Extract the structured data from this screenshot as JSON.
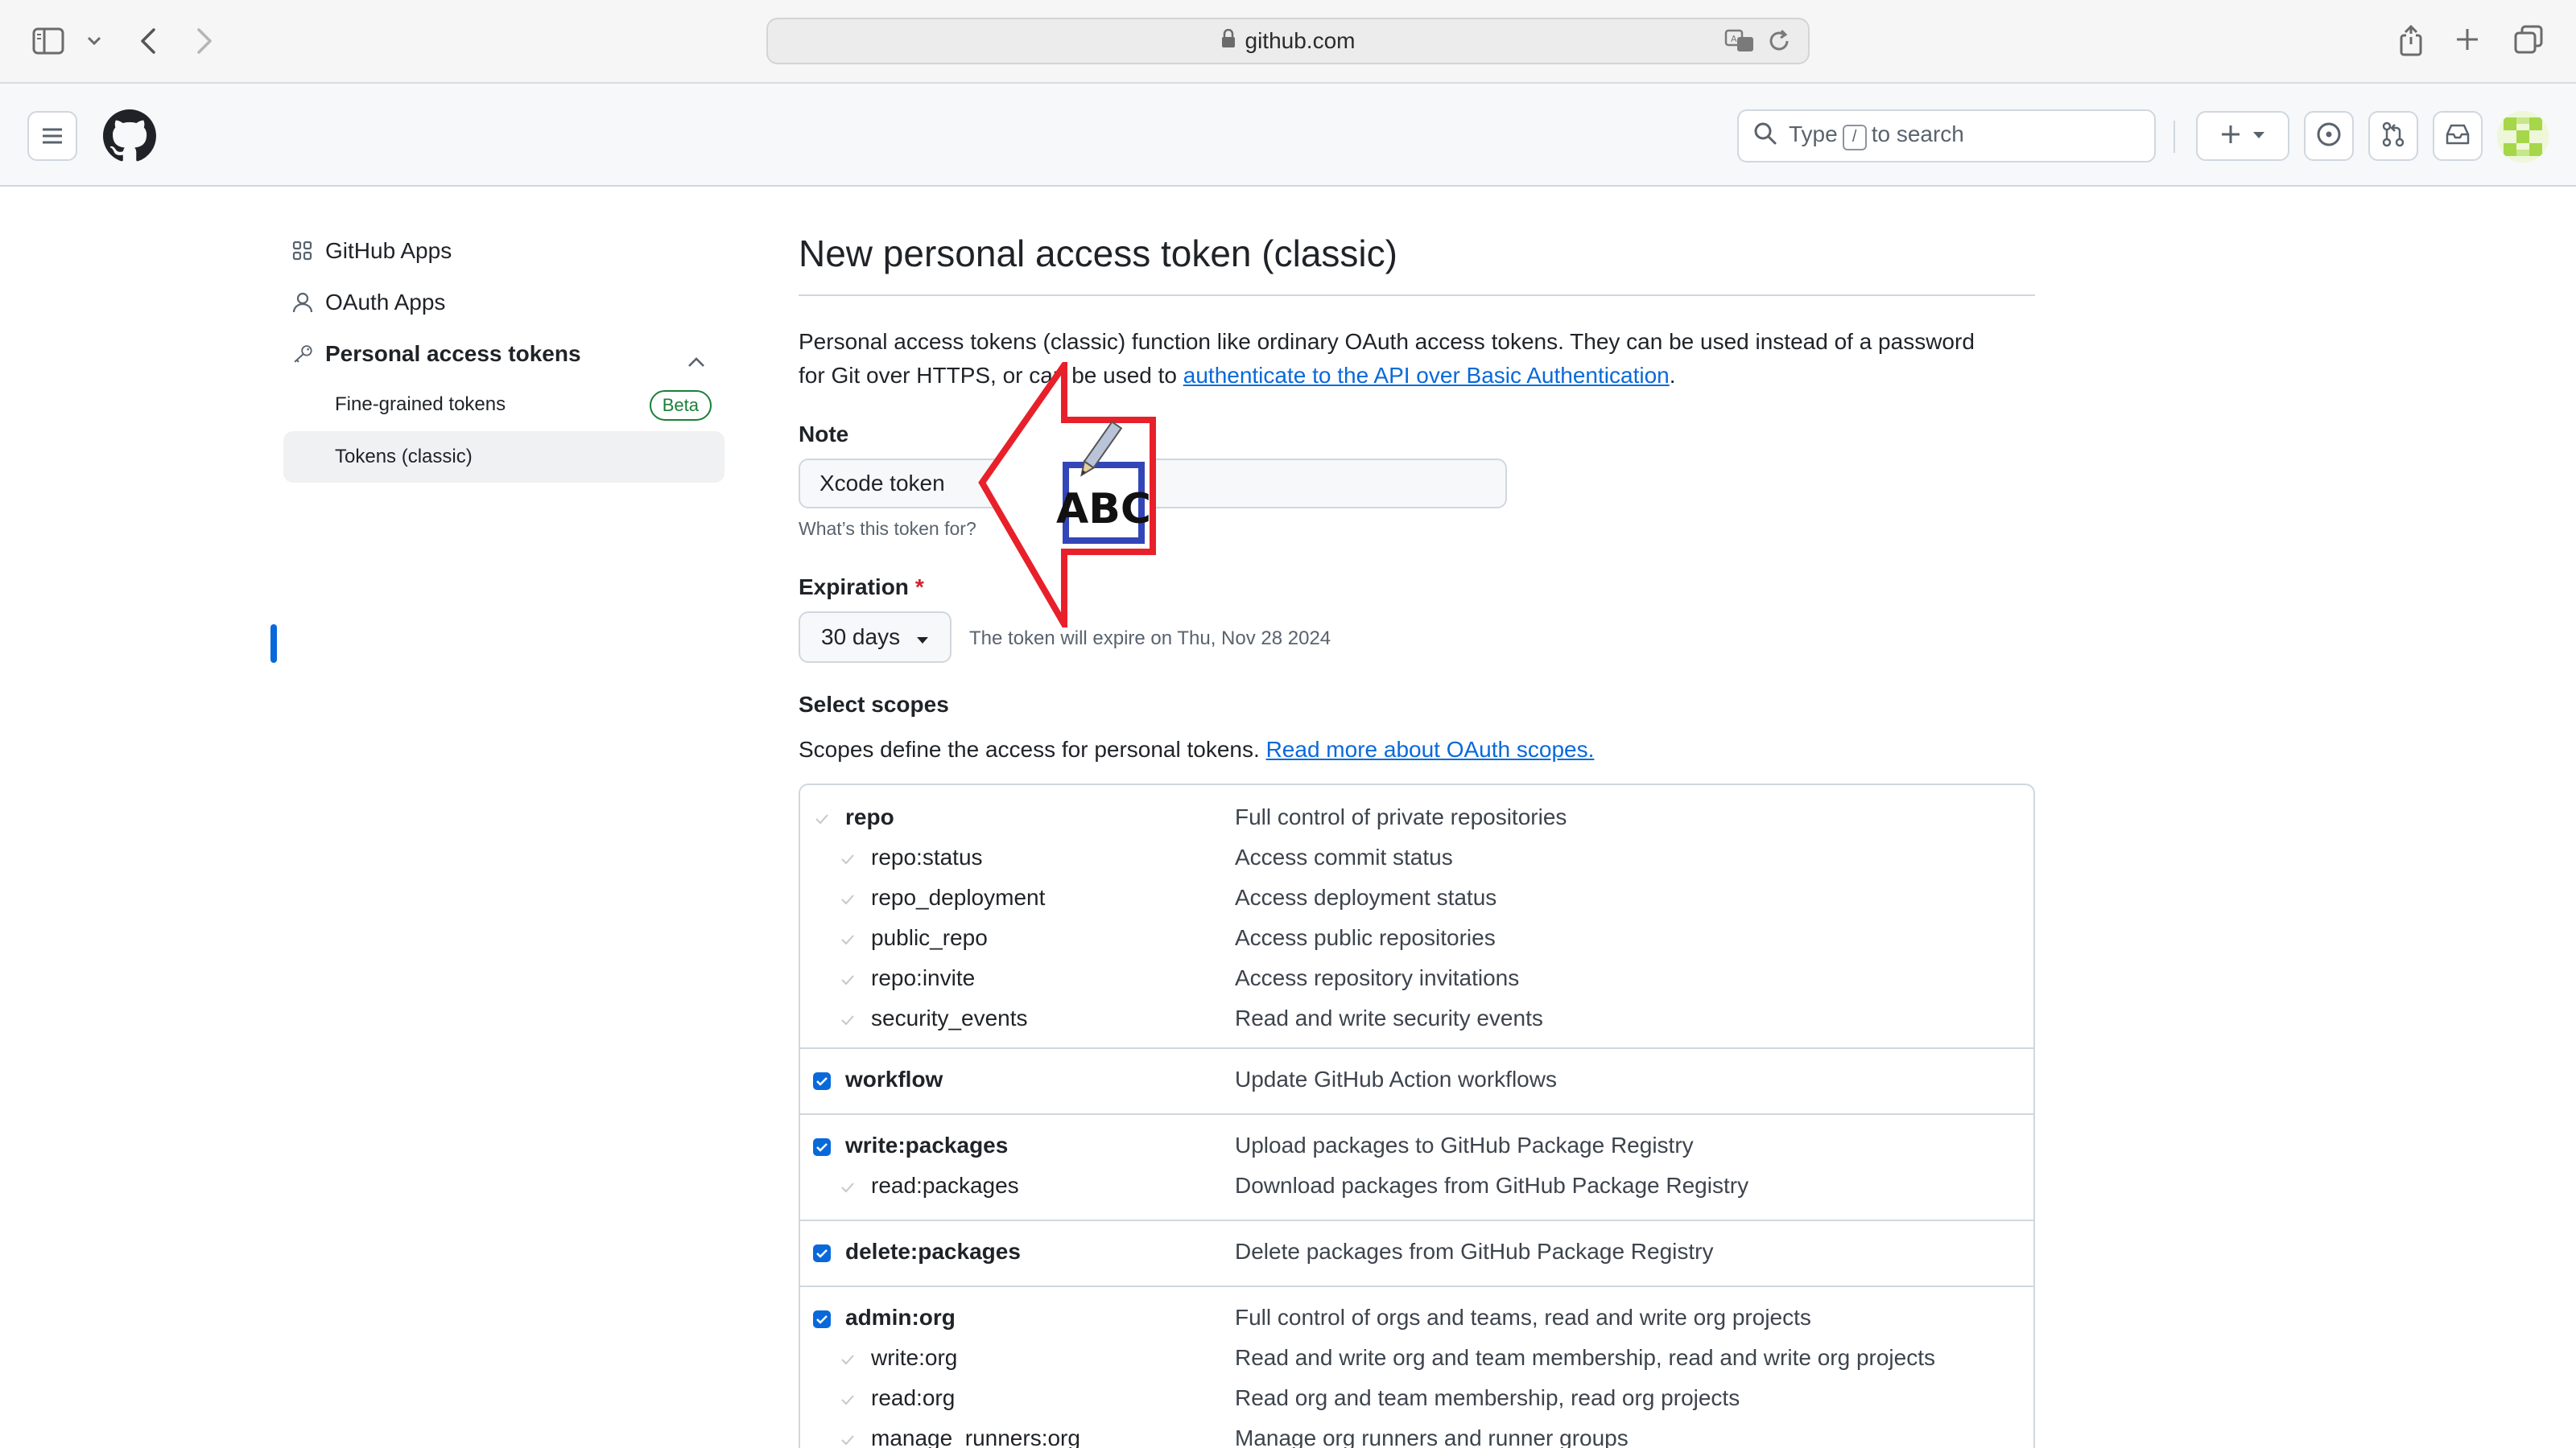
{
  "browser": {
    "url": "github.com",
    "icons": [
      "sidebar-icon",
      "chevron-down-icon",
      "back-icon",
      "forward-icon",
      "lock-icon",
      "translate-icon",
      "reload-icon",
      "share-icon",
      "new-tab-icon",
      "tab-overview-icon"
    ]
  },
  "header": {
    "search_prefix": "Type",
    "search_key": "/",
    "search_suffix": "to search",
    "icons": [
      "hamburger-icon",
      "github-logo-icon",
      "search-icon",
      "plus-icon",
      "chevron-down-icon",
      "issue-icon",
      "pull-request-icon",
      "inbox-icon"
    ]
  },
  "sidebar": {
    "github_apps": "GitHub Apps",
    "oauth_apps": "OAuth Apps",
    "personal_tokens": "Personal access tokens",
    "fine_grained": "Fine-grained tokens",
    "beta": "Beta",
    "tokens_classic": "Tokens (classic)"
  },
  "main": {
    "title": "New personal access token (classic)",
    "intro_1": "Personal access tokens (classic) function like ordinary OAuth access tokens. They can be used instead of a password",
    "intro_2": "for Git over HTTPS, or can be used to",
    "intro_link": "authenticate to the API over Basic Authentication",
    "intro_end": ".",
    "note_label": "Note",
    "note_value": "Xcode token",
    "note_hint": "What’s this token for?",
    "expiration_label": "Expiration",
    "required_mark": "*",
    "expiration_value": "30 days",
    "expiration_text": "The token will expire on Thu, Nov 28 2024",
    "scopes_label": "Select scopes",
    "scopes_desc": "Scopes define the access for personal tokens.",
    "scopes_link": "Read more about OAuth scopes."
  },
  "scopes": [
    {
      "name": "repo",
      "desc": "Full control of private repositories"
    },
    {
      "name": "repo:status",
      "desc": "Access commit status"
    },
    {
      "name": "repo_deployment",
      "desc": "Access deployment status"
    },
    {
      "name": "public_repo",
      "desc": "Access public repositories"
    },
    {
      "name": "repo:invite",
      "desc": "Access repository invitations"
    },
    {
      "name": "security_events",
      "desc": "Read and write security events"
    },
    {
      "name": "workflow",
      "desc": "Update GitHub Action workflows"
    },
    {
      "name": "write:packages",
      "desc": "Upload packages to GitHub Package Registry"
    },
    {
      "name": "read:packages",
      "desc": "Download packages from GitHub Package Registry"
    },
    {
      "name": "delete:packages",
      "desc": "Delete packages from GitHub Package Registry"
    },
    {
      "name": "admin:org",
      "desc": "Full control of orgs and teams, read and write org projects"
    },
    {
      "name": "write:org",
      "desc": "Read and write org and team membership, read and write org projects"
    },
    {
      "name": "read:org",
      "desc": "Read org and team membership, read org projects"
    },
    {
      "name": "manage_runners:org",
      "desc": "Manage org runners and runner groups"
    }
  ],
  "scope_checked": {
    "repo": false,
    "workflow": true,
    "write_packages": true,
    "delete_packages": true,
    "admin_org": true
  },
  "annotation": {
    "text": "ABC",
    "arrow_color": "#e8202a",
    "box_color": "#3346b8"
  },
  "colors": {
    "accent": "#0969da",
    "beta": "#1a7f37",
    "required": "#cf222e"
  }
}
